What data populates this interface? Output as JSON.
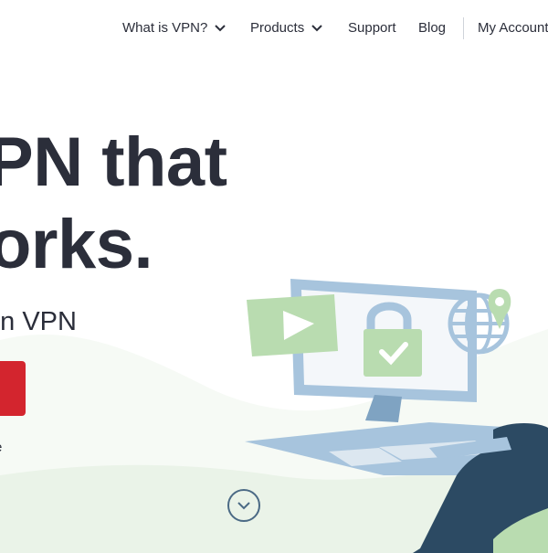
{
  "nav": {
    "items": [
      {
        "label": "What is VPN?",
        "has_dropdown": true
      },
      {
        "label": "Products",
        "has_dropdown": true
      },
      {
        "label": "Support",
        "has_dropdown": false
      },
      {
        "label": "Blog",
        "has_dropdown": false
      },
      {
        "label": "My Account",
        "has_dropdown": false
      }
    ]
  },
  "hero": {
    "headline_line1": "PN that",
    "headline_line2": "orks.",
    "subheadline": "r in VPN",
    "small_text": "e"
  },
  "colors": {
    "text": "#2b2e3a",
    "cta": "#d3252e",
    "illustration_green": "#b9dcb0",
    "illustration_blue": "#a7c4dd",
    "illustration_navy": "#2c4a63",
    "wave_green": "#eef6ec"
  },
  "icons": [
    "chevron-down-icon",
    "play-icon",
    "padlock-check-icon",
    "globe-icon",
    "location-pin-icon",
    "scroll-down-chevron-icon"
  ]
}
